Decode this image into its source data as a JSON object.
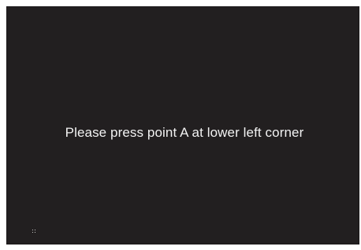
{
  "calibration": {
    "instruction": "Please press point A at lower left corner"
  },
  "colors": {
    "background": "#221f20",
    "text": "#f2f2f2",
    "marker": "#c8c8c8"
  },
  "icons": {
    "target": "calibration-point-marker"
  }
}
